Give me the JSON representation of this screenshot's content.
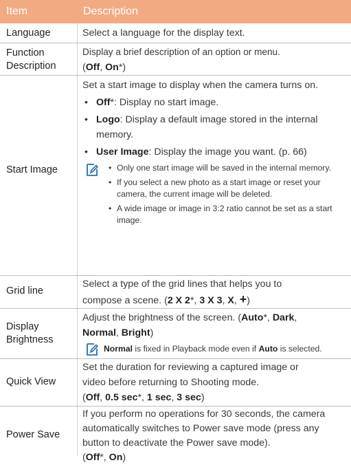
{
  "header": {
    "item": "Item",
    "description": "Description"
  },
  "rows": {
    "language": {
      "item": "Language",
      "desc": "Select a language for the display text."
    },
    "function_description": {
      "item_line1": "Function",
      "item_line2": "Description",
      "desc_line1": "Display a brief description of an option or menu.",
      "opt_open": "(",
      "opt_off": "Off",
      "sep": ", ",
      "opt_on": "On",
      "opt_close": "*)"
    },
    "start_image": {
      "item": "Start Image",
      "intro": "Set a start image to display when the camera turns on.",
      "b1_label": "Off",
      "b1_text": "*: Display no start image.",
      "b2_label": "Logo",
      "b2_text": ": Display a default image stored in the internal memory.",
      "b3_label": "User Image",
      "b3_text": ": Display the image you want. (p. 66)",
      "note_icon": "note-pencil-icon",
      "n1": "Only one start image will be saved in the internal memory.",
      "n2": "If you select a new photo as a start image or reset your camera, the current image will be deleted.",
      "n3": "A wide image or image in 3:2 ratio cannot be set as a start image."
    },
    "grid_line": {
      "item": "Grid line",
      "desc_line1": "Select a type of the grid lines that helps you to",
      "desc_line2": "compose a scene. (",
      "o1": "2 X 2",
      "star": "*",
      "sep": ", ",
      "o2": "3 X 3",
      "o3": "X",
      "o4": "+",
      "close": ")"
    },
    "display_brightness": {
      "item_line1": "Display",
      "item_line2": "Brightness",
      "desc_open": "Adjust the brightness of the screen. (",
      "o1": "Auto",
      "star": "*",
      "sep": ", ",
      "o2": "Dark",
      "o3": "Normal",
      "o4": "Bright",
      "close": ")",
      "note_label": "Normal",
      "note_mid": " is fixed in Playback mode even if ",
      "note_label2": "Auto",
      "note_end": " is selected."
    },
    "quick_view": {
      "item": "Quick View",
      "desc_line1": "Set the duration for reviewing a captured image or",
      "desc_line2": "video before returning to Shooting mode.",
      "open": "(",
      "o1": "Off",
      "sep": ", ",
      "o2": "0.5 sec",
      "star": "*",
      "o3": "1 sec",
      "o4": "3 sec",
      "close": ")"
    },
    "power_save": {
      "item": "Power Save",
      "desc": "If you perform no operations for 30 seconds, the camera automatically switches to Power save mode (press any button to deactivate the Power save mode).",
      "open": "(",
      "o1": "Off",
      "star": "*",
      "sep": ", ",
      "o2": "On",
      "close": ")"
    }
  },
  "colors": {
    "header_bg": "#f2aa82",
    "rule": "#bdbdbd",
    "icon": "#1e6fb0"
  }
}
